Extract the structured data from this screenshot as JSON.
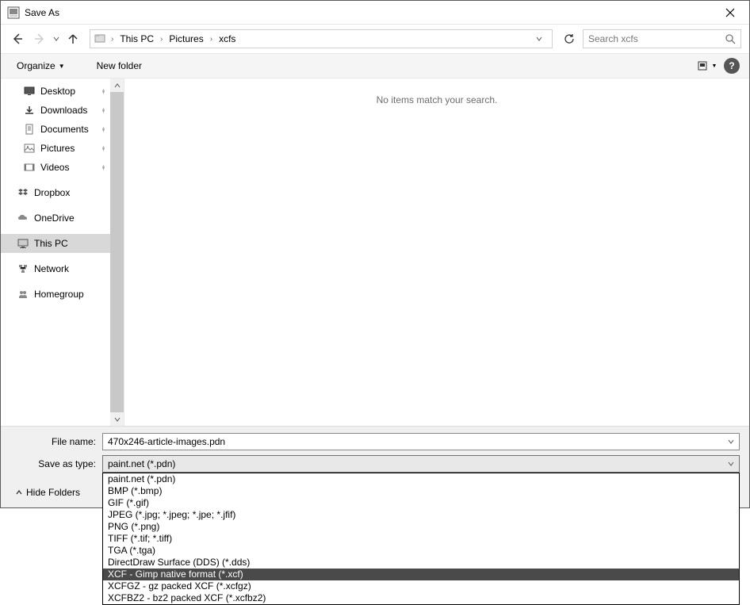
{
  "title": "Save As",
  "nav": {
    "breadcrumbs": [
      "This PC",
      "Pictures",
      "xcfs"
    ],
    "search_placeholder": "Search xcfs"
  },
  "commandbar": {
    "organize": "Organize",
    "new_folder": "New folder"
  },
  "sidebar": {
    "items": [
      {
        "label": "Desktop",
        "icon": "desktop",
        "pinned": true
      },
      {
        "label": "Downloads",
        "icon": "downloads",
        "pinned": true
      },
      {
        "label": "Documents",
        "icon": "documents",
        "pinned": true
      },
      {
        "label": "Pictures",
        "icon": "pictures",
        "pinned": true
      },
      {
        "label": "Videos",
        "icon": "videos",
        "pinned": true
      }
    ],
    "roots": [
      {
        "label": "Dropbox",
        "icon": "dropbox"
      },
      {
        "label": "OneDrive",
        "icon": "onedrive"
      },
      {
        "label": "This PC",
        "icon": "thispc",
        "selected": true
      },
      {
        "label": "Network",
        "icon": "network"
      },
      {
        "label": "Homegroup",
        "icon": "homegroup"
      }
    ]
  },
  "content": {
    "empty_message": "No items match your search."
  },
  "form": {
    "filename_label": "File name:",
    "filename_value": "470x246-article-images.pdn",
    "saveastype_label": "Save as type:",
    "saveastype_value": "paint.net (*.pdn)"
  },
  "dropdown": {
    "options": [
      "paint.net (*.pdn)",
      "BMP (*.bmp)",
      "GIF (*.gif)",
      "JPEG (*.jpg; *.jpeg; *.jpe; *.jfif)",
      "PNG (*.png)",
      "TIFF (*.tif; *.tiff)",
      "TGA (*.tga)",
      "DirectDraw Surface (DDS) (*.dds)",
      "XCF - Gimp native format (*.xcf)",
      "XCFGZ - gz packed XCF (*.xcfgz)",
      "XCFBZ2 - bz2 packed XCF (*.xcfbz2)"
    ],
    "highlighted_index": 8
  },
  "footer": {
    "hide_folders": "Hide Folders"
  }
}
